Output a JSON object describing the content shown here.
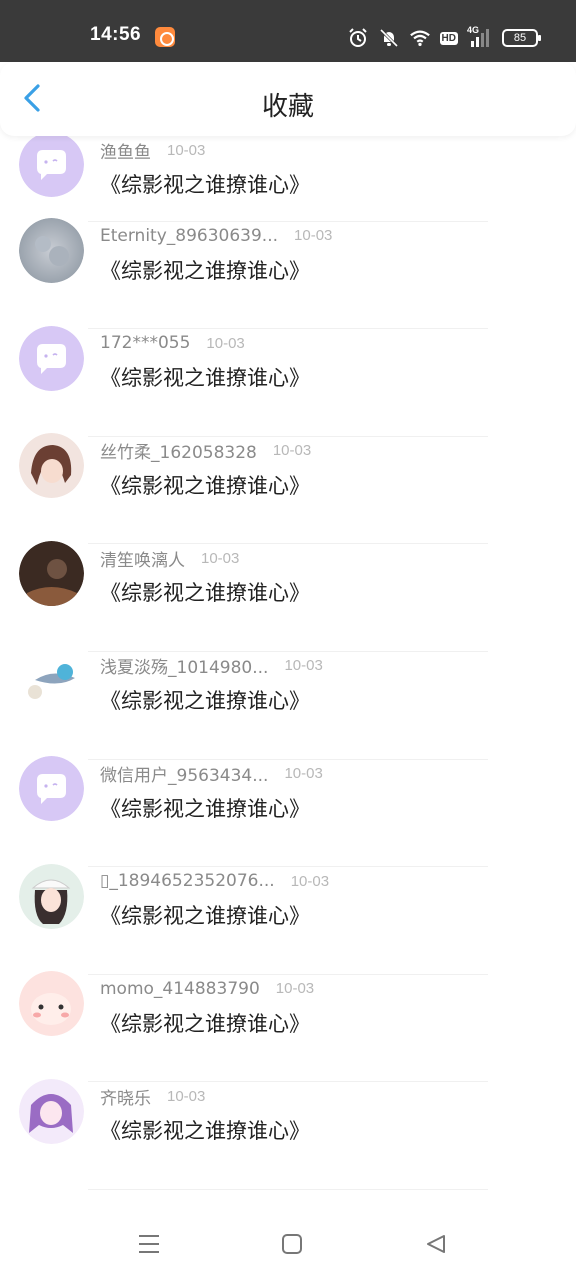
{
  "status_bar": {
    "time": "14:56",
    "hd": "HD",
    "network": "4G",
    "battery": "85",
    "icons": [
      "app-notification-icon",
      "alarm-icon",
      "mute-bell-icon",
      "wifi-icon",
      "hd-icon",
      "signal-4g-icon",
      "battery-icon"
    ]
  },
  "header": {
    "title": "收藏",
    "back_icon": "chevron-left-icon",
    "accent_color": "#3aa0e6"
  },
  "favorites": [
    {
      "user": "渔鱼鱼",
      "date": "10-03",
      "title": "《综影视之谁撩谁心》",
      "avatar": "default-chat-avatar"
    },
    {
      "user": "Eternity_89630639...",
      "date": "10-03",
      "title": "《综影视之谁撩谁心》",
      "avatar": "photo-avatar"
    },
    {
      "user": "172***055",
      "date": "10-03",
      "title": "《综影视之谁撩谁心》",
      "avatar": "default-chat-avatar"
    },
    {
      "user": "丝竹柔_162058328",
      "date": "10-03",
      "title": "《综影视之谁撩谁心》",
      "avatar": "photo-avatar"
    },
    {
      "user": "清笙唤漓人",
      "date": "10-03",
      "title": "《综影视之谁撩谁心》",
      "avatar": "photo-avatar"
    },
    {
      "user": "浅夏淡殇_1014980...",
      "date": "10-03",
      "title": "《综影视之谁撩谁心》",
      "avatar": "photo-avatar"
    },
    {
      "user": "微信用户_9563434...",
      "date": "10-03",
      "title": "《综影视之谁撩谁心》",
      "avatar": "default-chat-avatar"
    },
    {
      "user": "▯_1894652352076...",
      "date": "10-03",
      "title": "《综影视之谁撩谁心》",
      "avatar": "photo-avatar"
    },
    {
      "user": "momo_414883790",
      "date": "10-03",
      "title": "《综影视之谁撩谁心》",
      "avatar": "photo-avatar"
    },
    {
      "user": "齐晓乐",
      "date": "10-03",
      "title": "《综影视之谁撩谁心》",
      "avatar": "photo-avatar"
    }
  ],
  "nav_bar": {
    "icons": [
      "menu-icon",
      "home-square-icon",
      "back-triangle-icon"
    ]
  }
}
